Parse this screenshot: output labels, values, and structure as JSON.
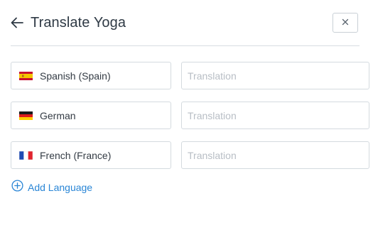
{
  "header": {
    "title": "Translate Yoga"
  },
  "languages": [
    {
      "label": "Spanish (Spain)",
      "flag": "es-flag-icon",
      "translation_value": "",
      "translation_placeholder": "Translation"
    },
    {
      "label": "German",
      "flag": "de-flag-icon",
      "translation_value": "",
      "translation_placeholder": "Translation"
    },
    {
      "label": "French (France)",
      "flag": "fr-flag-icon",
      "translation_value": "",
      "translation_placeholder": "Translation"
    }
  ],
  "add_language": {
    "label": "Add Language",
    "icon": "plus-circle-icon"
  },
  "colors": {
    "accent": "#2a86d6",
    "border": "#d4dadf",
    "title": "#2f3a45",
    "placeholder": "#b8bec5"
  }
}
